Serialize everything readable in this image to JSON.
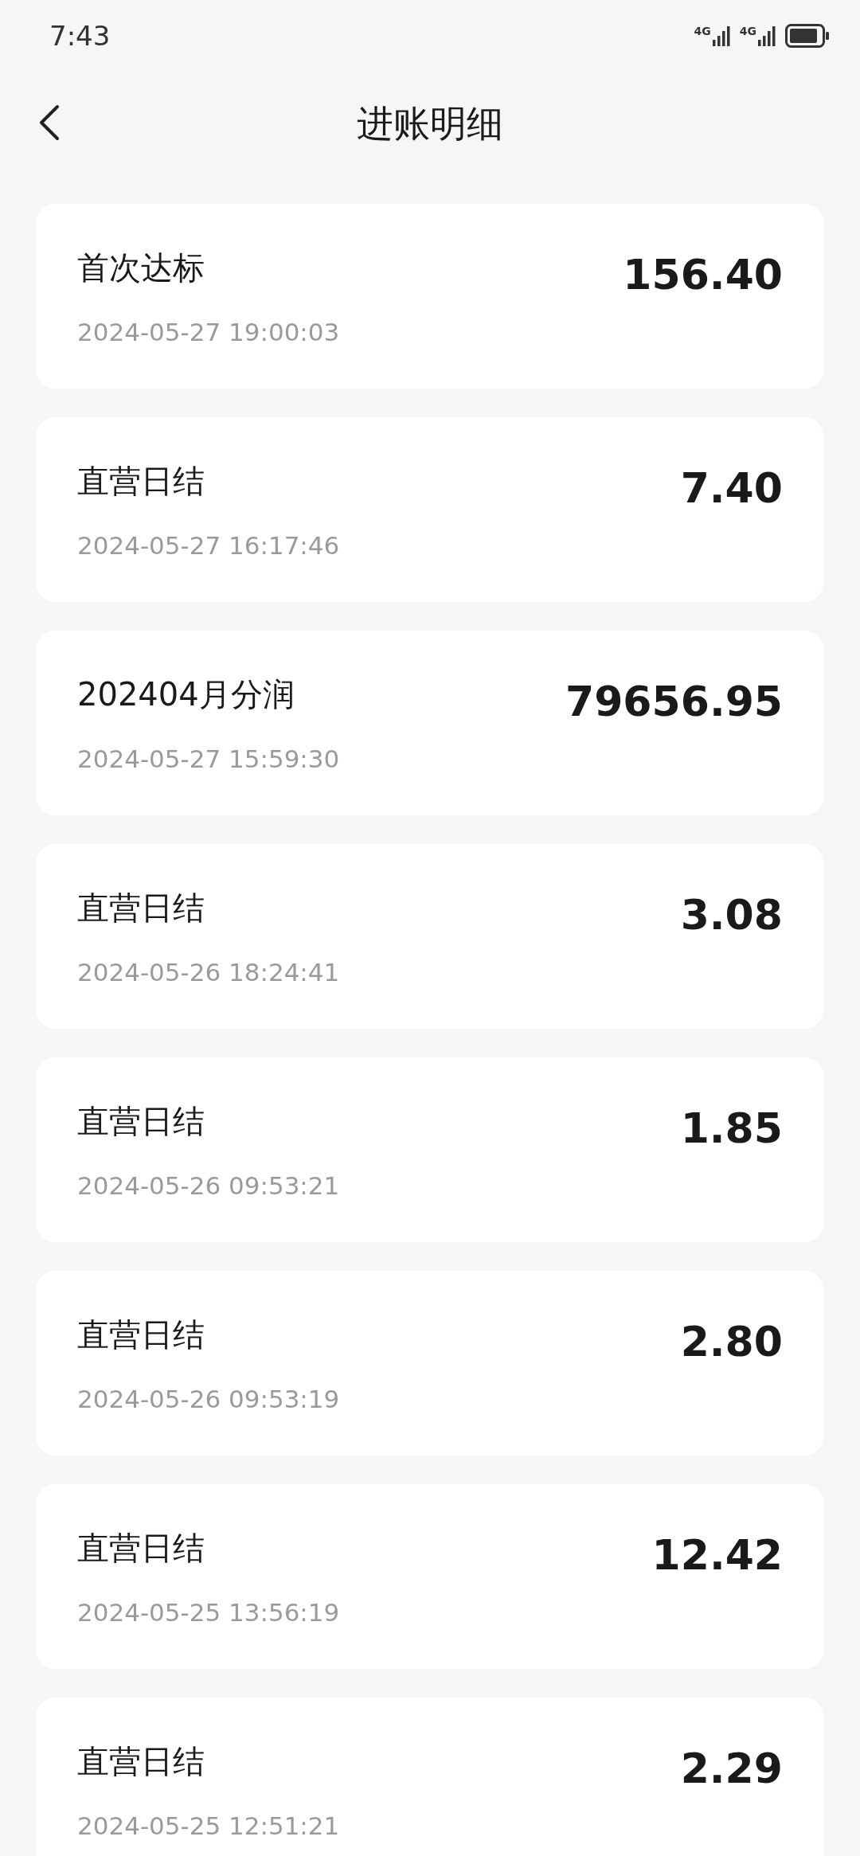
{
  "status_bar": {
    "time": "7:43",
    "signals": [
      {
        "network": "4G"
      },
      {
        "network": "4G"
      }
    ]
  },
  "header": {
    "title": "进账明细"
  },
  "entries": [
    {
      "title": "首次达标",
      "date": "2024-05-27 19:00:03",
      "amount": "156.40"
    },
    {
      "title": "直营日结",
      "date": "2024-05-27 16:17:46",
      "amount": "7.40"
    },
    {
      "title": "202404月分润",
      "date": "2024-05-27 15:59:30",
      "amount": "79656.95"
    },
    {
      "title": "直营日结",
      "date": "2024-05-26 18:24:41",
      "amount": "3.08"
    },
    {
      "title": "直营日结",
      "date": "2024-05-26 09:53:21",
      "amount": "1.85"
    },
    {
      "title": "直营日结",
      "date": "2024-05-26 09:53:19",
      "amount": "2.80"
    },
    {
      "title": "直营日结",
      "date": "2024-05-25 13:56:19",
      "amount": "12.42"
    },
    {
      "title": "直营日结",
      "date": "2024-05-25 12:51:21",
      "amount": "2.29"
    }
  ]
}
